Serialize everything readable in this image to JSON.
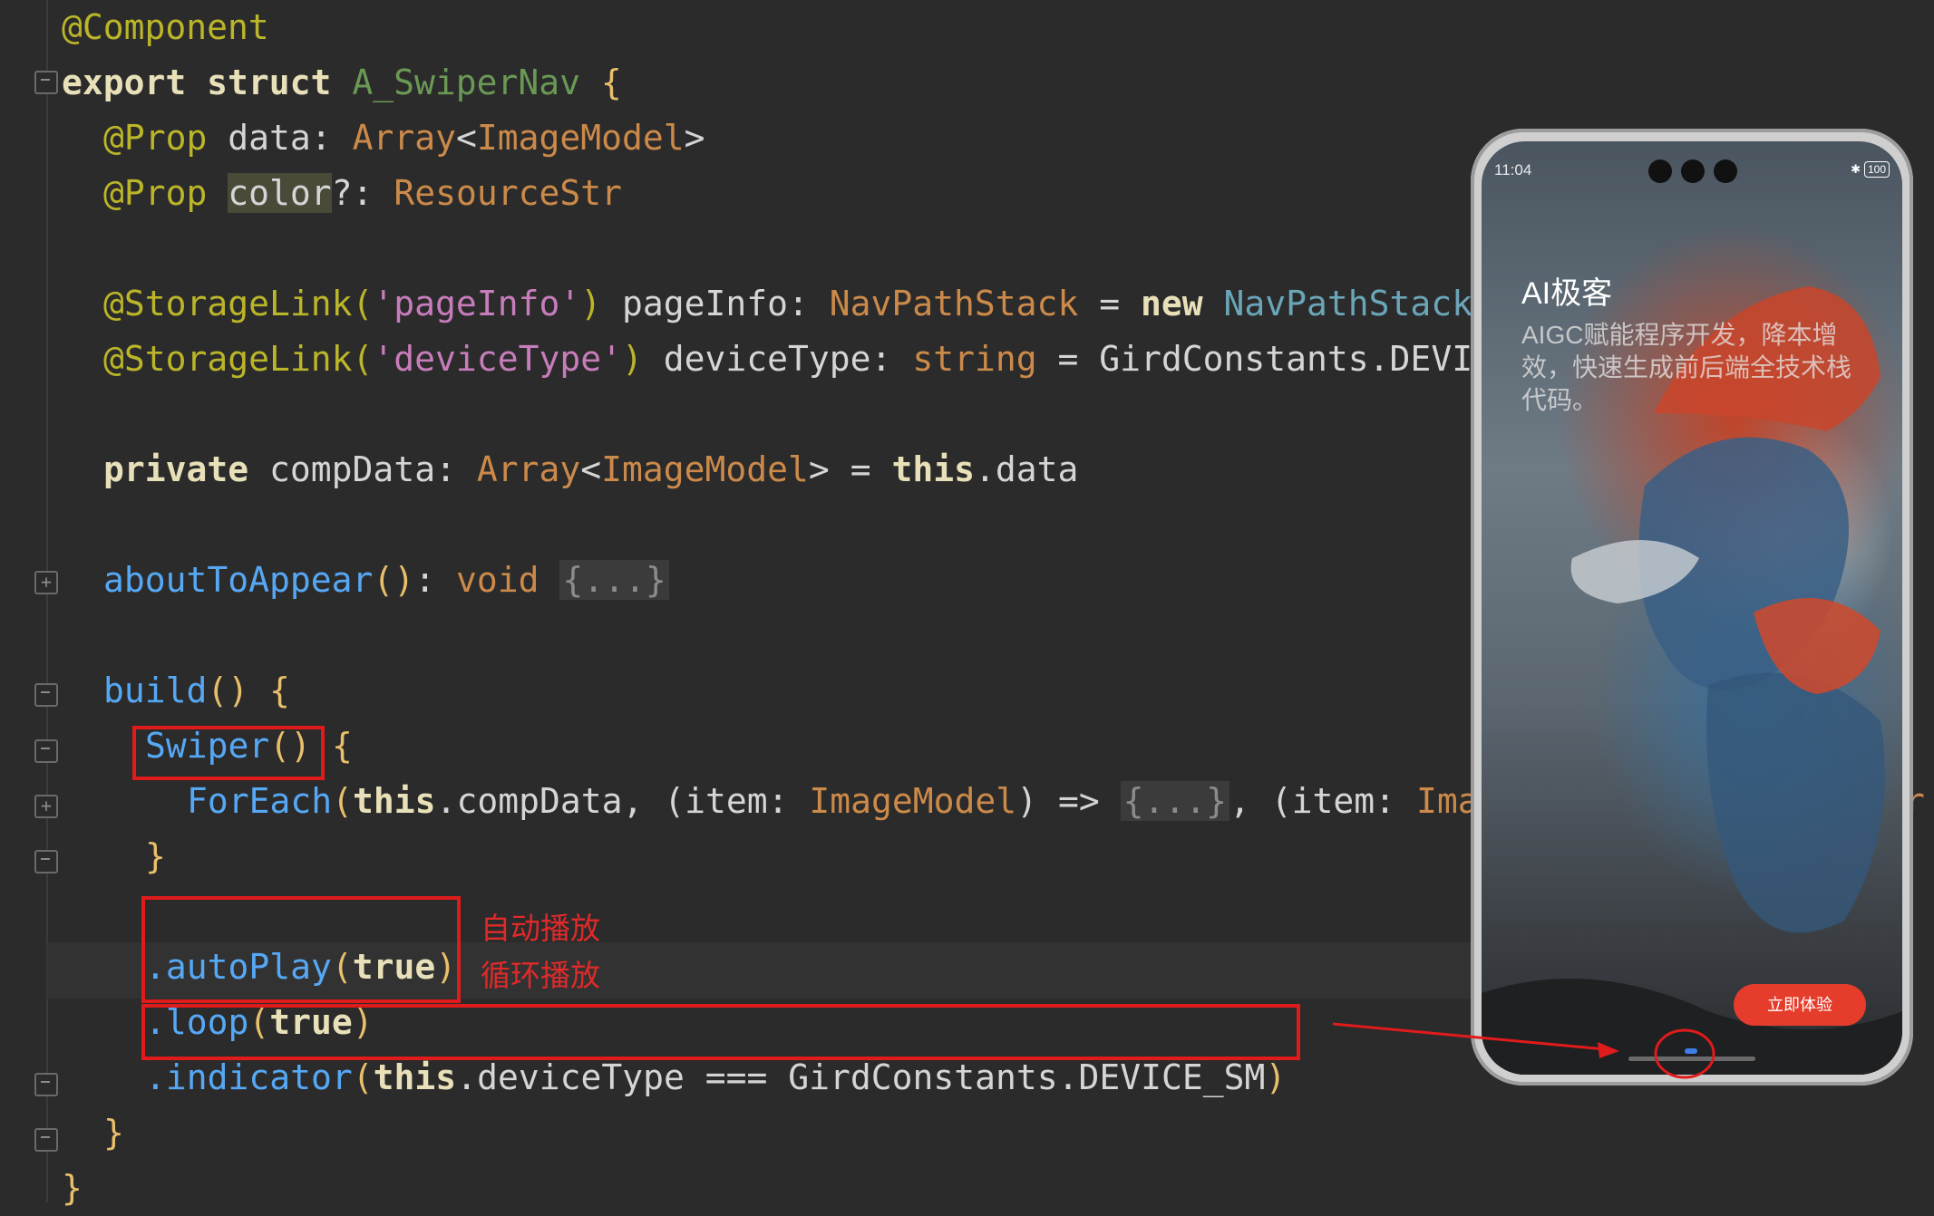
{
  "editor": {
    "lines": {
      "l1": "@Component",
      "l2_kw": "export struct",
      "l2_name": "A_SwiperNav",
      "l3_ann": "@Prop",
      "l3_var": "data:",
      "l3_type": "Array",
      "l3_generic": "ImageModel",
      "l4_ann": "@Prop",
      "l4_var": "color",
      "l4_opt": "?:",
      "l4_type": "ResourceStr",
      "l6_ann": "@StorageLink(",
      "l6_str": "'pageInfo'",
      "l6_close": ")",
      "l6_var": "pageInfo:",
      "l6_type": "NavPathStack",
      "l6_new": "new",
      "l6_ctor": "NavPathStack",
      "l7_ann": "@StorageLink(",
      "l7_str": "'deviceType'",
      "l7_close": ")",
      "l7_var": "deviceType:",
      "l7_type": "string",
      "l7_val": "GirdConstants.DEVI",
      "l9_kw": "private",
      "l9_var": "compData:",
      "l9_type": "Array",
      "l9_generic": "ImageModel",
      "l9_this": "this",
      "l9_prop": ".data",
      "l11_fn": "aboutToAppear",
      "l11_ret": "void",
      "l11_fold": "{...}",
      "l13_fn": "build",
      "l14_fn": "Swiper",
      "l15_fn": "ForEach",
      "l15_this": "this",
      "l15_prop": ".compData,",
      "l15_param": "(item:",
      "l15_type": "ImageModel",
      "l15_arrow": "=>",
      "l15_fold": "{...}",
      "l15_param2": "(item:",
      "l15_type2": "Ima",
      "l15_tail": "r",
      "l17_fn": ".autoPlay",
      "l17_arg": "true",
      "l18_fn": ".loop",
      "l18_arg": "true",
      "l19_fn": ".indicator",
      "l19_this": "this",
      "l19_rest": ".deviceType === GirdConstants.DEVICE_SM"
    },
    "notes": {
      "autoplay": "自动播放",
      "loop": "循环播放"
    }
  },
  "phone": {
    "status_time": "11:04",
    "battery": "100",
    "title": "AI极客",
    "description": "AIGC赋能程序开发，降本增效，快速生成前后端全技术栈代码。",
    "cta_button": "立即体验"
  },
  "colors": {
    "annotation_red": "#e01b1b",
    "editor_bg": "#2b2b2b",
    "button_red": "#e63c2b",
    "indicator_active": "#3f7ee8"
  }
}
